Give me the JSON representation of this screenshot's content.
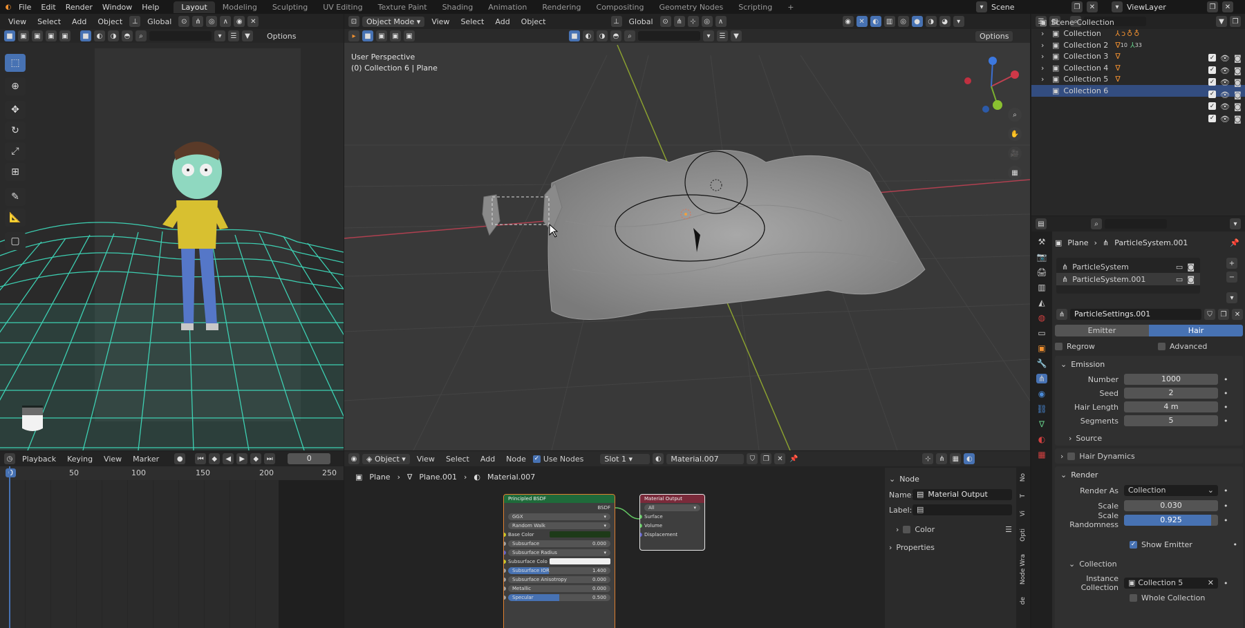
{
  "top_menu": [
    "File",
    "Edit",
    "Render",
    "Window",
    "Help"
  ],
  "workspaces": [
    "Layout",
    "Modeling",
    "Sculpting",
    "UV Editing",
    "Texture Paint",
    "Shading",
    "Animation",
    "Rendering",
    "Compositing",
    "Geometry Nodes",
    "Scripting"
  ],
  "active_workspace": "Layout",
  "scene_name": "Scene",
  "view_layer": "ViewLayer",
  "left_viewport": {
    "header_items": [
      "View",
      "Select",
      "Add",
      "Object"
    ],
    "orientation": "Global",
    "options_label": "Options"
  },
  "main_viewport": {
    "mode": "Object Mode",
    "menus": [
      "View",
      "Select",
      "Add",
      "Object"
    ],
    "orientation": "Global",
    "options_label": "Options",
    "perspective_label": "User Perspective",
    "context_label": "(0) Collection 6 | Plane"
  },
  "timeline": {
    "menus": [
      "Playback",
      "Keying",
      "View",
      "Marker"
    ],
    "current_frame": "0",
    "ruler": [
      "0",
      "50",
      "100",
      "150",
      "200",
      "250"
    ]
  },
  "node_editor": {
    "type": "Object",
    "menus": [
      "View",
      "Select",
      "Add",
      "Node"
    ],
    "use_nodes_label": "Use Nodes",
    "slot": "Slot 1",
    "material": "Material.007",
    "breadcrumb": [
      "Plane",
      "Plane.001",
      "Material.007"
    ],
    "bsdf_node": {
      "title": "Principled BSDF",
      "output": "BSDF",
      "distribution": "GGX",
      "subsurface_method": "Random Walk",
      "rows": [
        {
          "label": "Base Color",
          "value": ""
        },
        {
          "label": "Subsurface",
          "value": "0.000"
        },
        {
          "label": "Subsurface Radius",
          "value": ""
        },
        {
          "label": "Subsurface Colo",
          "value": ""
        },
        {
          "label": "Subsurface IOR",
          "value": "1.400"
        },
        {
          "label": "Subsurface Anisotropy",
          "value": "0.000"
        },
        {
          "label": "Metallic",
          "value": "0.000"
        },
        {
          "label": "Specular",
          "value": "0.500"
        }
      ]
    },
    "output_node": {
      "title": "Material Output",
      "target": "All",
      "inputs": [
        "Surface",
        "Volume",
        "Displacement"
      ]
    },
    "side_panel": {
      "section": "Node",
      "name_label": "Name:",
      "name_value": "Material Output",
      "label_label": "Label:",
      "label_value": "",
      "color_label": "Color",
      "properties_label": "Properties",
      "tabs": [
        "No",
        "T",
        "Vi",
        "Opti",
        "Node Wra",
        "de"
      ]
    }
  },
  "outliner": {
    "root": "Scene Collection",
    "items": [
      {
        "name": "Collection",
        "selected": false
      },
      {
        "name": "Collection 2",
        "selected": false
      },
      {
        "name": "Collection 3",
        "selected": false
      },
      {
        "name": "Collection 4",
        "selected": false
      },
      {
        "name": "Collection 5",
        "selected": false
      },
      {
        "name": "Collection 6",
        "selected": true
      }
    ],
    "badges": {
      "collection_2_a": "10",
      "collection_2_b": "33"
    }
  },
  "properties": {
    "breadcrumb": [
      "Plane",
      "ParticleSystem.001"
    ],
    "systems": [
      "ParticleSystem",
      "ParticleSystem.001"
    ],
    "settings_name": "ParticleSettings.001",
    "tabs": [
      "Emitter",
      "Hair"
    ],
    "active_tab": "Hair",
    "regrow_label": "Regrow",
    "advanced_label": "Advanced",
    "emission": {
      "title": "Emission",
      "rows": [
        {
          "label": "Number",
          "value": "1000"
        },
        {
          "label": "Seed",
          "value": "2"
        },
        {
          "label": "Hair Length",
          "value": "4 m"
        },
        {
          "label": "Segments",
          "value": "5"
        }
      ],
      "source_label": "Source"
    },
    "hair_dynamics_label": "Hair Dynamics",
    "render": {
      "title": "Render",
      "render_as_label": "Render As",
      "render_as_value": "Collection",
      "scale_label": "Scale",
      "scale_value": "0.030",
      "scale_random_label": "Scale Randomness",
      "scale_random_value": "0.925",
      "scale_random_fraction": 0.925,
      "show_emitter_label": "Show Emitter",
      "collection_section": "Collection",
      "instance_collection_label": "Instance Collection",
      "instance_collection_value": "Collection 5",
      "whole_collection_label": "Whole Collection"
    }
  },
  "colors": {
    "accent": "#4772b3",
    "grid": "#3fe0c0",
    "x_axis": "#b04050",
    "y_axis": "#8aa030"
  }
}
